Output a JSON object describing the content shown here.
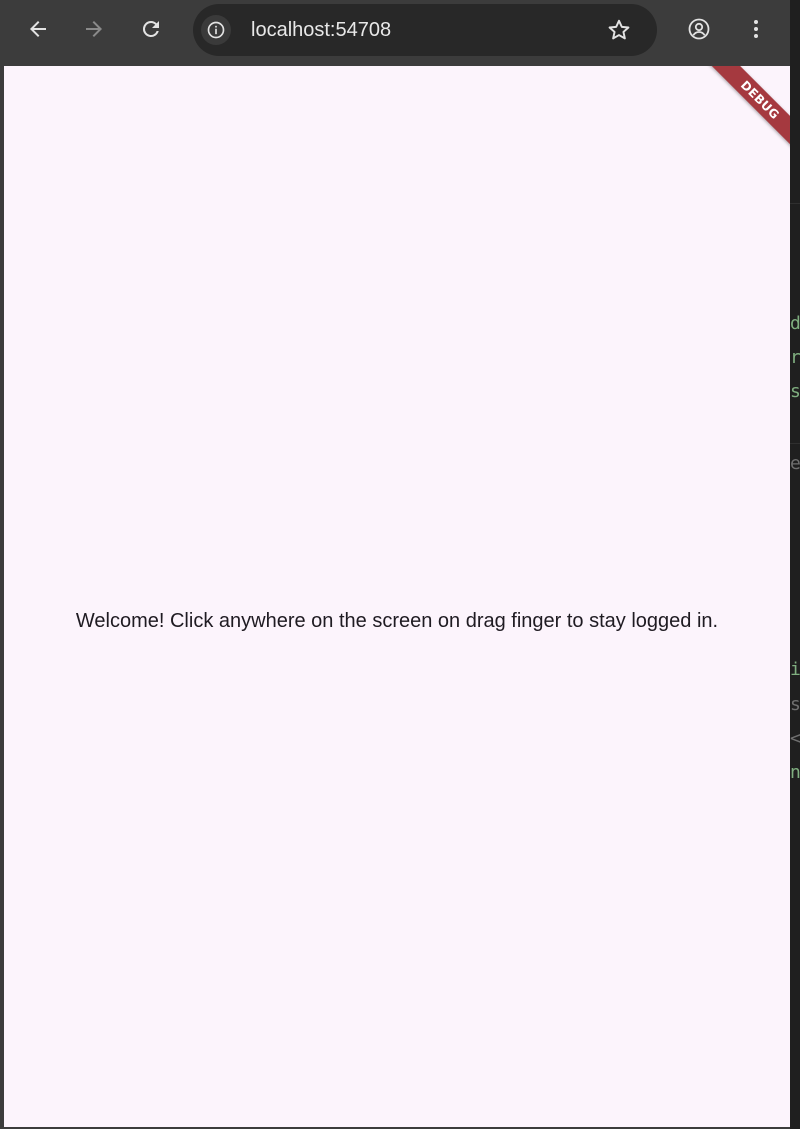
{
  "browser": {
    "url": "localhost:54708",
    "back_icon": "arrow-left-icon",
    "forward_icon": "arrow-right-icon",
    "reload_icon": "reload-icon",
    "info_icon": "info-icon",
    "bookmark_icon": "star-icon",
    "profile_icon": "account-circle-icon",
    "menu_icon": "more-vert-icon"
  },
  "app": {
    "welcome_text": "Welcome! Click anywhere on the screen on drag finger to stay logged in.",
    "debug_label": "DEBUG",
    "background_color": "#fcf4fc",
    "debug_banner_color": "#a5393f"
  },
  "background_editor": {
    "glyphs": [
      "d",
      "r",
      "s",
      "e",
      "i",
      "s",
      "<",
      "n"
    ]
  }
}
